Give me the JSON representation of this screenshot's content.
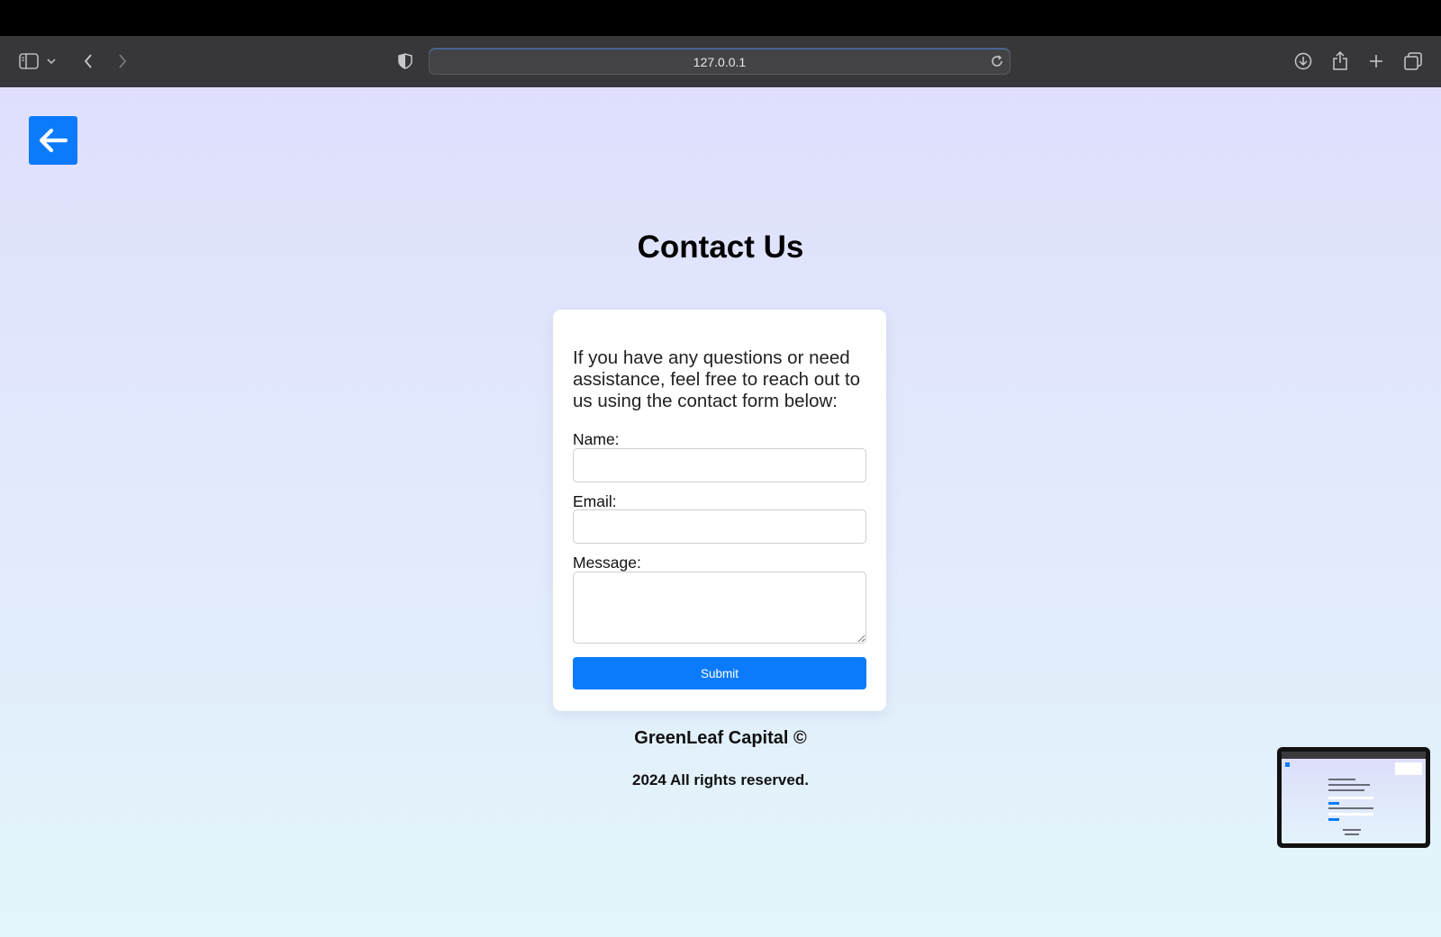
{
  "browser": {
    "url": "127.0.0.1",
    "icons": [
      "sidebar-icon",
      "chevron-down-icon",
      "back-icon",
      "forward-icon",
      "shield-icon",
      "reload-icon",
      "download-icon",
      "share-icon",
      "plus-icon",
      "tabs-icon"
    ]
  },
  "page": {
    "back_icon": "arrow-left-icon",
    "title": "Contact Us",
    "intro": "If you have any questions or need assistance, feel free to reach out to us using the contact form below:",
    "form": {
      "name_label": "Name:",
      "email_label": "Email:",
      "message_label": "Message:",
      "name_value": "",
      "email_value": "",
      "message_value": "",
      "submit_label": "Submit"
    },
    "footer": {
      "brand": "GreenLeaf Capital ©",
      "rights": "2024 All rights reserved."
    }
  },
  "colors": {
    "accent": "#0b7bfc",
    "toolbar": "#37373a",
    "background_top": "#dfdffd",
    "background_bottom": "#e3f6fb"
  }
}
